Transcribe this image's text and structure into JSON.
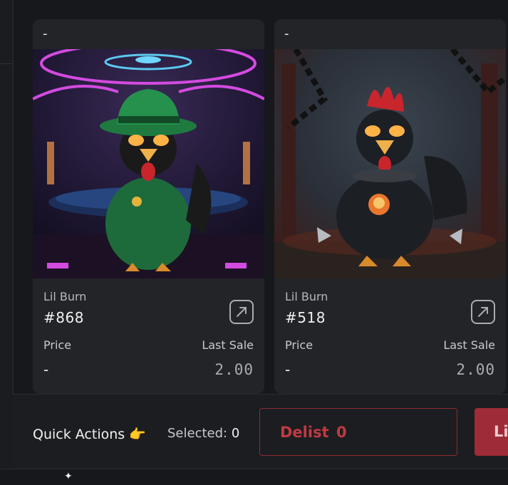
{
  "cards": [
    {
      "badge": "-",
      "collection": "Lil Burn",
      "token": "#868",
      "price_label": "Price",
      "price": "-",
      "last_sale_label": "Last Sale",
      "last_sale": "2.00",
      "art_theme": "green-suit-rooster-nightclub"
    },
    {
      "badge": "-",
      "collection": "Lil Burn",
      "token": "#518",
      "price_label": "Price",
      "price": "-",
      "last_sale_label": "Last Sale",
      "last_sale": "2.00",
      "art_theme": "black-rooster-skull-chains"
    }
  ],
  "bottom_bar": {
    "quick_actions_label": "Quick Actions",
    "hand_emoji": "👉",
    "selected_label": "Selected:",
    "selected_count": "0",
    "delist_label": "Delist",
    "delist_count": "0",
    "list_label": "Li"
  },
  "colors": {
    "background": "#17181b",
    "card": "#222428",
    "delist_accent": "#c03a42",
    "list_button": "#9e2c36"
  },
  "icons": [
    "open-external-icon",
    "sparkle-icon"
  ]
}
